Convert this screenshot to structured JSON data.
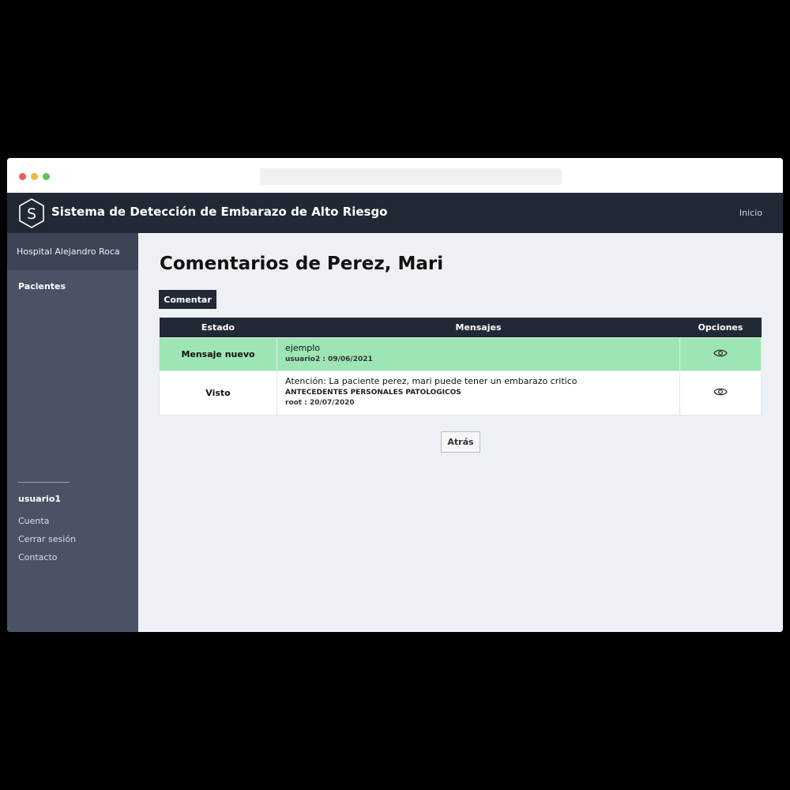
{
  "navbar": {
    "logo_letter": "S",
    "title": "Sistema de Detección de Embarazo de Alto Riesgo",
    "inicio_label": "Inicio"
  },
  "sidebar": {
    "hospital": "Hospital Alejandro Roca",
    "pacientes_label": "Pacientes",
    "username": "usuario1",
    "links": [
      "Cuenta",
      "Cerrar sesión",
      "Contacto"
    ]
  },
  "main": {
    "title": "Comentarios de Perez, Mari",
    "comentar_label": "Comentar",
    "table": {
      "headers": {
        "estado": "Estado",
        "mensajes": "Mensajes",
        "opciones": "Opciones"
      },
      "rows": [
        {
          "estado": "Mensaje nuevo",
          "mensaje": "ejemplo",
          "subtitulo": "",
          "meta": "usuario2 : 09/06/2021",
          "opcion_icon": "eye-icon"
        },
        {
          "estado": "Visto",
          "mensaje": "Atención: La paciente perez, mari puede tener un embarazo critico",
          "subtitulo": "ANTECEDENTES PERSONALES PATOLOGICOS",
          "meta": "root : 20/07/2020",
          "opcion_icon": "eye-icon"
        }
      ]
    },
    "atras_label": "Atrás"
  },
  "colors": {
    "navbar_bg": "#212836",
    "sidebar_bg": "#4a5366",
    "new_message_row": "#9ee5b5",
    "main_bg": "#edf0f4"
  }
}
